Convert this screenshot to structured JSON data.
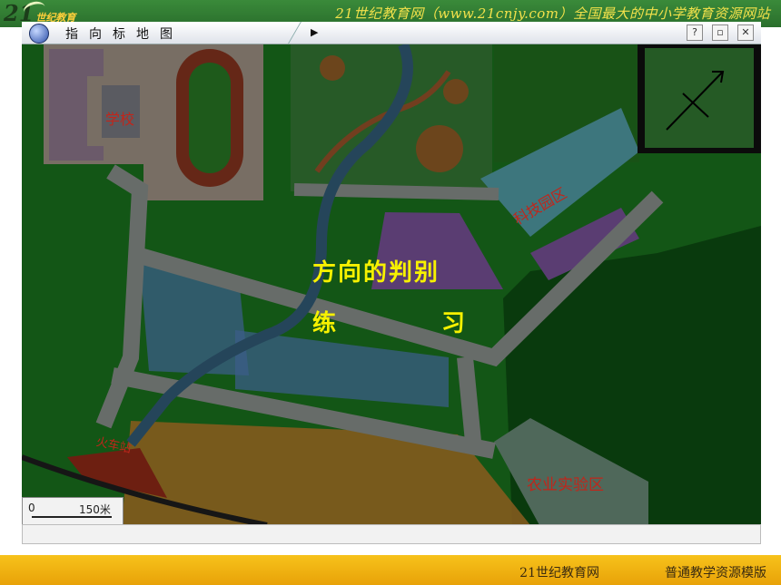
{
  "header": {
    "logo_text": "21",
    "logo_sub": "世纪教育",
    "site_title": "21世纪教育网（www.21cnjy.com）全国最大的中小学教育资源网站"
  },
  "window": {
    "title": "指向标地图",
    "buttons": {
      "help": "?",
      "restore": "▫",
      "close": "✕"
    }
  },
  "map": {
    "title_line1": "方向的判别",
    "title_line2_a": "练",
    "title_line2_b": "习",
    "labels": {
      "school": "学校",
      "tech_park": "科技园区",
      "station": "火车站",
      "farm": "农业实验区"
    },
    "scale": {
      "start": "0",
      "end": "150米"
    }
  },
  "footer": {
    "left": "21世纪教育网",
    "right": "普通教学资源模版"
  },
  "colors": {
    "background_green": "#1b7b1f",
    "road": "#9fa7a2",
    "river": "#3a6b8a",
    "title_yellow": "#f7f100",
    "label_red": "#c0261b",
    "footer_orange": "#f0b010"
  }
}
